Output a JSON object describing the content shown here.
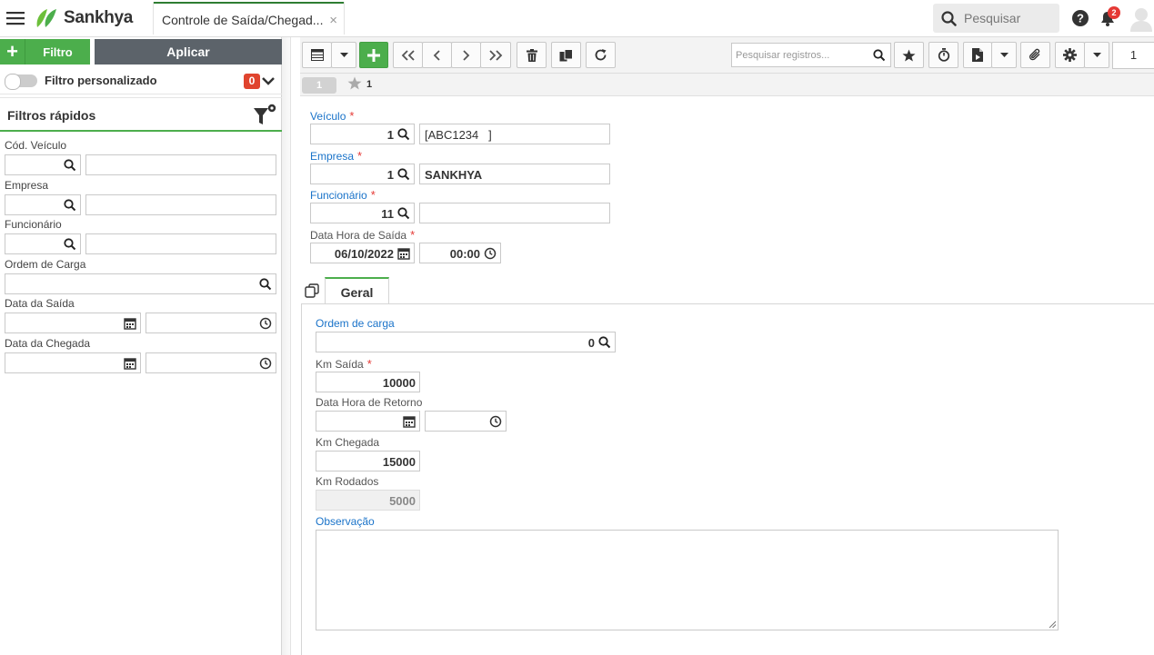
{
  "app": {
    "brand": "Sankhya",
    "tab_title": "Controle de Saída/Chegad...",
    "tab_close": "×",
    "search_placeholder": "Pesquisar",
    "notifications_count": "2",
    "brand_color": "#4cae4c"
  },
  "filter_panel": {
    "filter_button": "Filtro",
    "apply_button": "Aplicar",
    "custom_filter_label": "Filtro personalizado",
    "custom_filter_count": "0",
    "quick_filters_title": "Filtros rápidos",
    "fields": {
      "cod_veiculo": "Cód. Veículo",
      "empresa": "Empresa",
      "funcionario": "Funcionário",
      "ordem_carga": "Ordem de Carga",
      "data_saida": "Data da Saída",
      "data_chegada": "Data da Chegada"
    }
  },
  "toolbar": {
    "search_placeholder": "Pesquisar registros...",
    "page_number": "1"
  },
  "record_bar": {
    "record_index": "1",
    "favorites_count": "1"
  },
  "form": {
    "veiculo": {
      "label": "Veículo",
      "code": "1",
      "description": "[ABC1234   ]"
    },
    "empresa": {
      "label": "Empresa",
      "code": "1",
      "description": "SANKHYA"
    },
    "funcionario": {
      "label": "Funcionário",
      "code": "11",
      "description": ""
    },
    "data_hora_saida": {
      "label": "Data Hora de Saída",
      "date": "06/10/2022",
      "time": "00:00"
    },
    "required_mark": "*"
  },
  "tabs": [
    {
      "label": "Geral",
      "active": true
    }
  ],
  "geral": {
    "ordem_carga": {
      "label": "Ordem de carga",
      "value": "0"
    },
    "km_saida": {
      "label": "Km Saída",
      "value": "10000"
    },
    "data_hora_retorno": {
      "label": "Data Hora de Retorno",
      "date": "",
      "time": ""
    },
    "km_chegada": {
      "label": "Km Chegada",
      "value": "15000"
    },
    "km_rodados": {
      "label": "Km Rodados",
      "value": "5000"
    },
    "observacao": {
      "label": "Observação",
      "value": ""
    }
  }
}
